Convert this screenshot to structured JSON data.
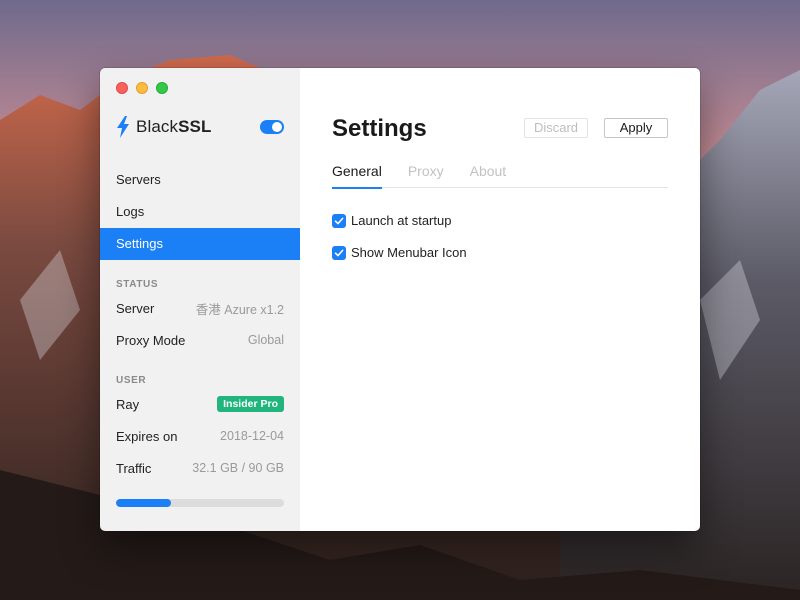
{
  "app": {
    "brand_primary": "Black",
    "brand_secondary": "SSL",
    "enabled": true,
    "accent_color": "#1b7ff5"
  },
  "sidebar": {
    "nav": [
      {
        "label": "Servers",
        "active": false
      },
      {
        "label": "Logs",
        "active": false
      },
      {
        "label": "Settings",
        "active": true
      }
    ],
    "status": {
      "title": "STATUS",
      "server_label": "Server",
      "server_value": "香港 Azure x1.2",
      "proxy_mode_label": "Proxy Mode",
      "proxy_mode_value": "Global"
    },
    "user": {
      "title": "USER",
      "name": "Ray",
      "badge": "Insider Pro",
      "badge_color": "#1fb57c",
      "expires_label": "Expires on",
      "expires_value": "2018-12-04",
      "traffic_label": "Traffic",
      "traffic_value": "32.1 GB / 90 GB",
      "traffic_used_fraction": 0.33
    }
  },
  "main": {
    "title": "Settings",
    "discard_label": "Discard",
    "apply_label": "Apply",
    "tabs": [
      {
        "label": "General",
        "active": true
      },
      {
        "label": "Proxy",
        "active": false
      },
      {
        "label": "About",
        "active": false
      }
    ],
    "options": [
      {
        "label": "Launch at startup",
        "checked": true
      },
      {
        "label": "Show Menubar Icon",
        "checked": true
      }
    ]
  }
}
